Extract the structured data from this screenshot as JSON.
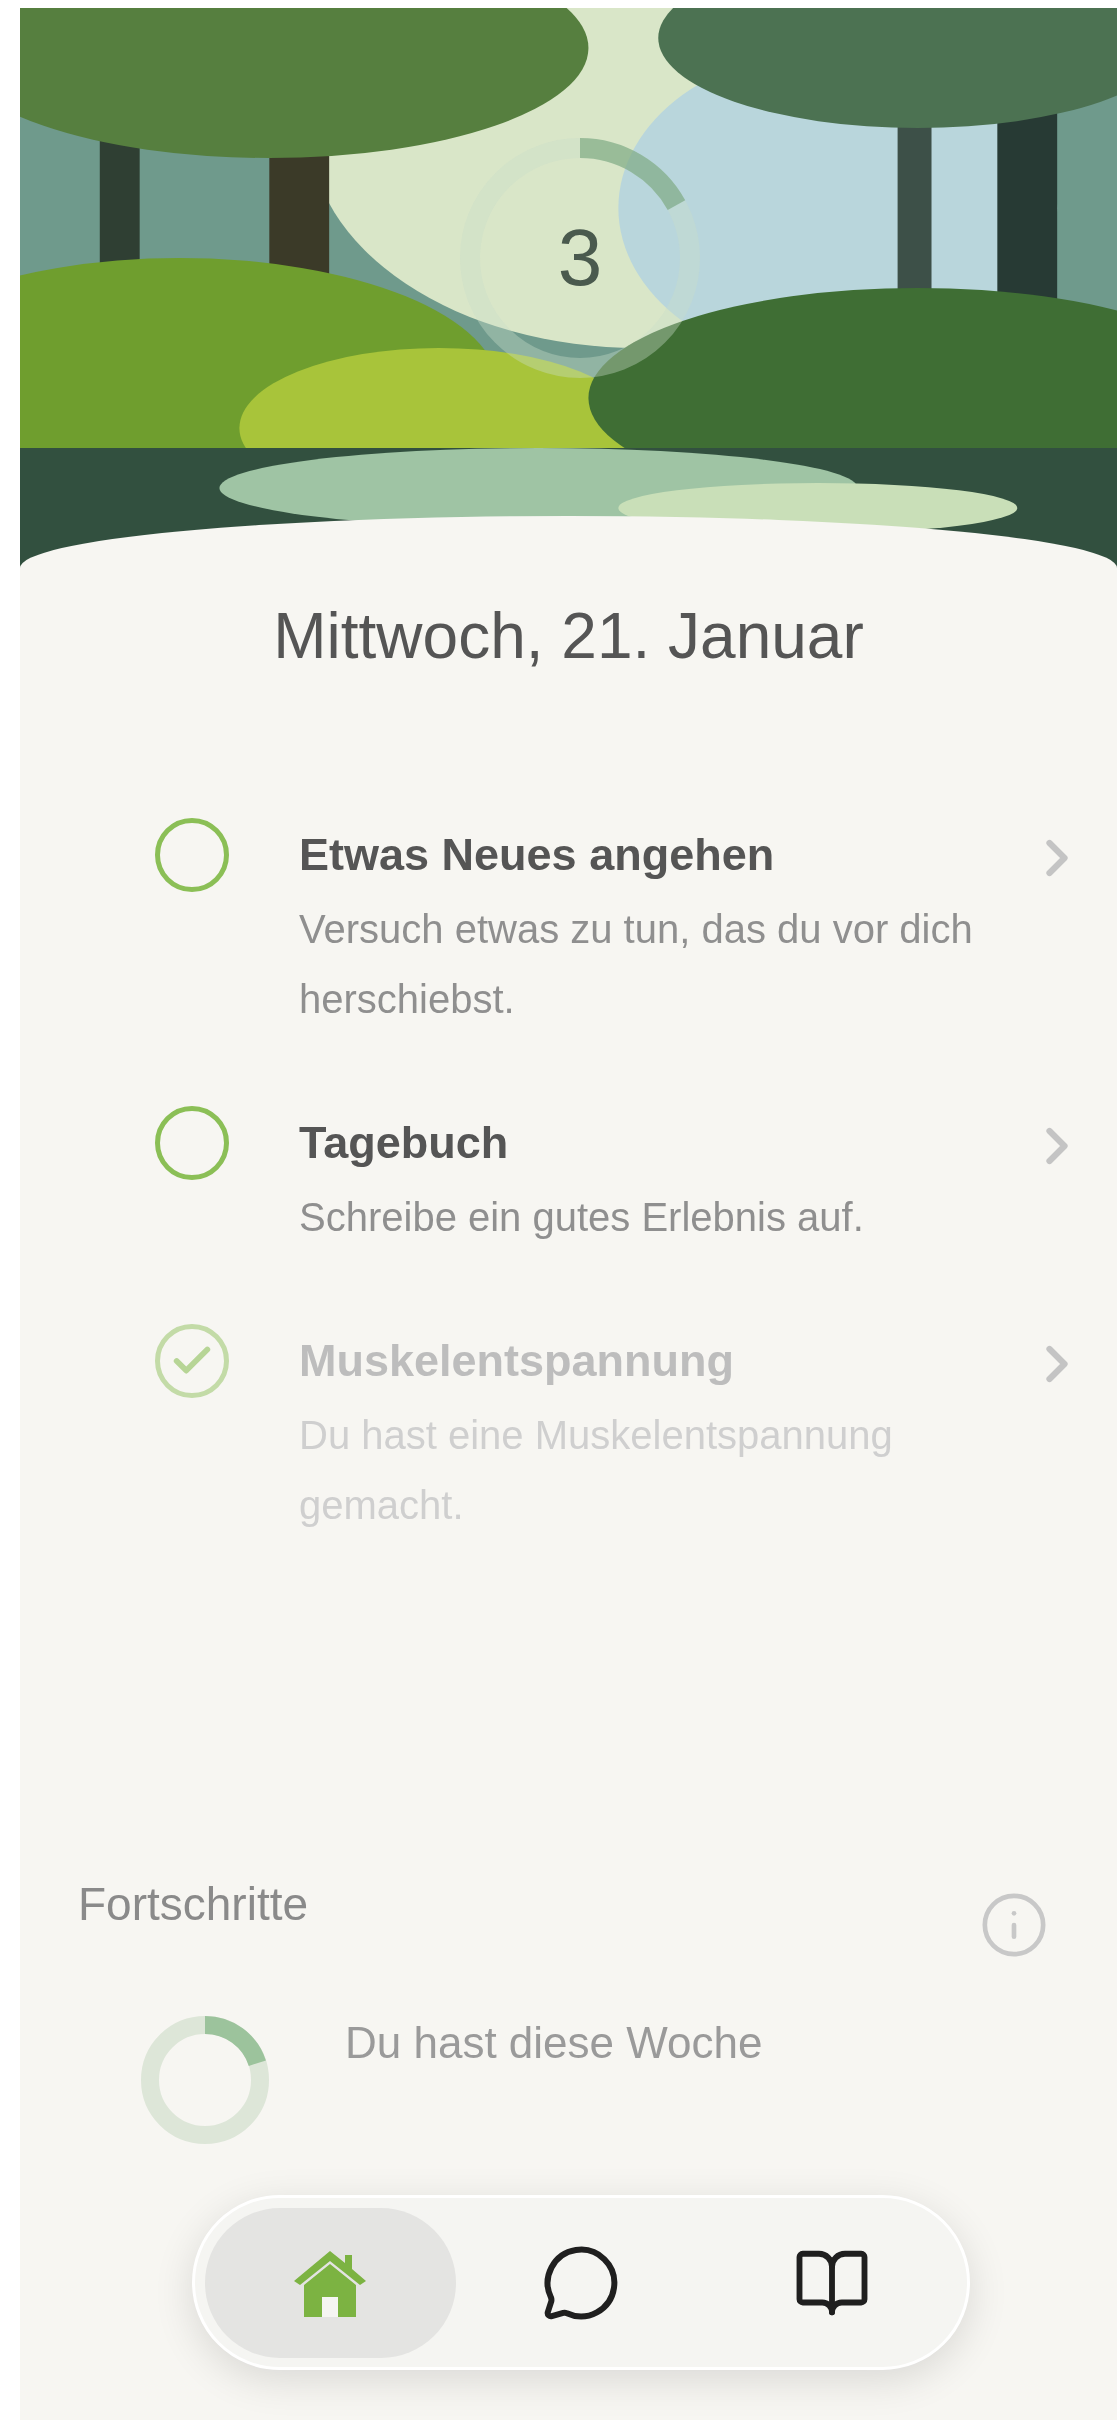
{
  "header": {
    "count": "3",
    "level": 0.17
  },
  "date": "Mittwoch, 21. Januar",
  "tasks": [
    {
      "title": "Etwas Neues angehen",
      "description": "Versuch etwas zu tun, das du vor dich herschiebst.",
      "done": false
    },
    {
      "title": "Tagebuch",
      "description": "Schreibe ein gutes Erlebnis auf.",
      "done": false
    },
    {
      "title": "Muskelentspannung",
      "description": "Du hast eine Muskelentspannung gemacht.",
      "done": true
    }
  ],
  "progress": {
    "title": "Fortschritte",
    "level": 0.2,
    "text": "Du hast diese Woche"
  },
  "nav": [
    {
      "kind": "home",
      "selected": true
    },
    {
      "kind": "chat",
      "selected": false
    },
    {
      "kind": "book",
      "selected": false
    }
  ]
}
